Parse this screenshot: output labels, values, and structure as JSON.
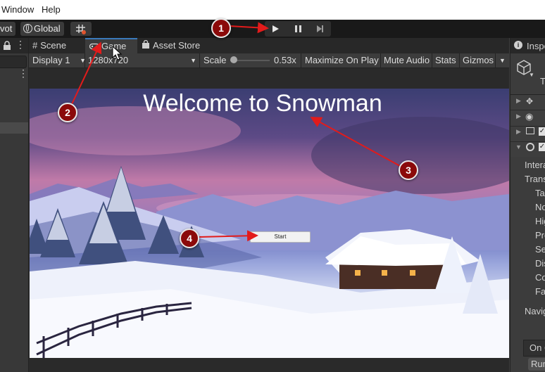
{
  "menubar": {
    "items": [
      "Window",
      "Help"
    ]
  },
  "toolbar": {
    "pivot_label": "vot",
    "global_label": "Global"
  },
  "tabs": [
    {
      "label": "Scene",
      "icon": "hash-icon"
    },
    {
      "label": "Game",
      "icon": "gamepad-icon"
    },
    {
      "label": "Asset Store",
      "icon": "shopping-bag-icon"
    }
  ],
  "game_toolbar": {
    "display": "Display 1",
    "resolution": "1280x720",
    "scale_label": "Scale",
    "scale_value": "0.53x",
    "maximize": "Maximize On Play",
    "mute": "Mute Audio",
    "stats": "Stats",
    "gizmos": "Gizmos"
  },
  "game": {
    "title": "Welcome to Snowman",
    "start_button": "Start"
  },
  "inspector": {
    "tab_label": "Inspe",
    "icon_letter": "T",
    "rows": [
      "Intera",
      "Trans",
      "Ta",
      "No",
      "Hig",
      "Pre",
      "Se",
      "Dis",
      "Co",
      "Fa",
      "Navig"
    ],
    "on_click": "On C",
    "runtime": "Run"
  },
  "annotations": [
    "1",
    "2",
    "3",
    "4"
  ],
  "colors": {
    "accent": "#3a79bb",
    "badge": "#8b0a0a",
    "arrow": "#e21b1b"
  }
}
